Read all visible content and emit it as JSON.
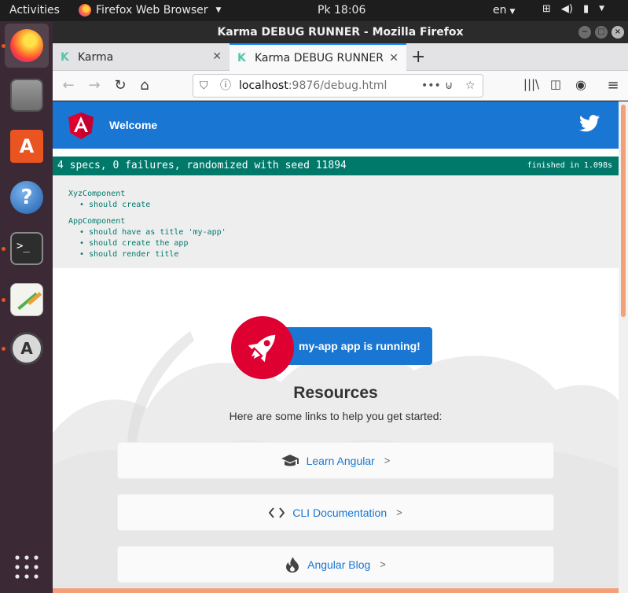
{
  "topbar": {
    "activities": "Activities",
    "app_name": "Firefox Web Browser",
    "clock": "Pk 18:06",
    "lang": "en"
  },
  "window": {
    "title": "Karma DEBUG RUNNER - Mozilla Firefox"
  },
  "tabs": [
    {
      "label": "Karma"
    },
    {
      "label": "Karma DEBUG RUNNER"
    }
  ],
  "url": {
    "host": "localhost",
    "rest": ":9876/debug.html"
  },
  "header": {
    "welcome": "Welcome"
  },
  "karma": {
    "summary": "4 specs, 0 failures, randomized with seed 11894",
    "time": "finished in 1.098s",
    "suites": [
      {
        "name": "XyzComponent",
        "specs": [
          "• should create"
        ]
      },
      {
        "name": "AppComponent",
        "specs": [
          "• should have as title 'my-app'",
          "• should create the app",
          "• should render title"
        ]
      }
    ]
  },
  "app": {
    "running": "my-app app is running!",
    "resources_title": "Resources",
    "resources_sub": "Here are some links to help you get started:",
    "links": [
      {
        "label": "Learn Angular",
        "icon": "graduation-cap-icon"
      },
      {
        "label": "CLI Documentation",
        "icon": "code-brackets-icon"
      },
      {
        "label": "Angular Blog",
        "icon": "flame-icon"
      }
    ]
  },
  "colors": {
    "angular_blue": "#1976d2",
    "angular_red": "#dd0031",
    "karma_green": "#00796b",
    "ubuntu_orange": "#e95420"
  }
}
